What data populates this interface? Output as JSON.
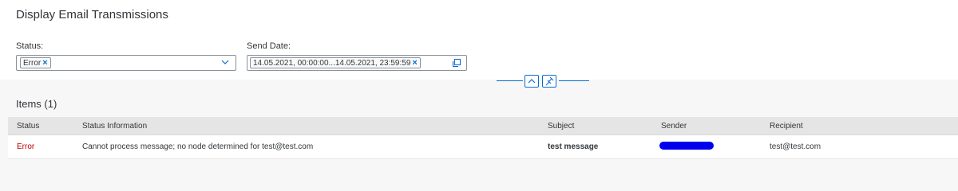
{
  "page": {
    "title": "Display Email Transmissions"
  },
  "filters": {
    "status": {
      "label": "Status:",
      "token": "Error"
    },
    "send_date": {
      "label": "Send Date:",
      "token": "14.05.2021, 00:00:00...14.05.2021, 23:59:59"
    }
  },
  "icons": {
    "token_remove": "×",
    "status_dropdown": "chevron-down-icon",
    "date_value_help": "copy-icon",
    "collapse_header": "chevron-up-icon",
    "pin_header": "pin-icon"
  },
  "items": {
    "title": "Items (1)",
    "columns": [
      "Status",
      "Status Information",
      "Subject",
      "Sender",
      "Recipient"
    ],
    "rows": [
      {
        "status": "Error",
        "status_information": "Cannot process message; no node determined for test@test.com",
        "subject": "test message",
        "recipient": "test@test.com"
      }
    ]
  },
  "colors": {
    "accent": "#0a6ed1",
    "error": "#bb0000",
    "redaction": "#0000ee"
  }
}
